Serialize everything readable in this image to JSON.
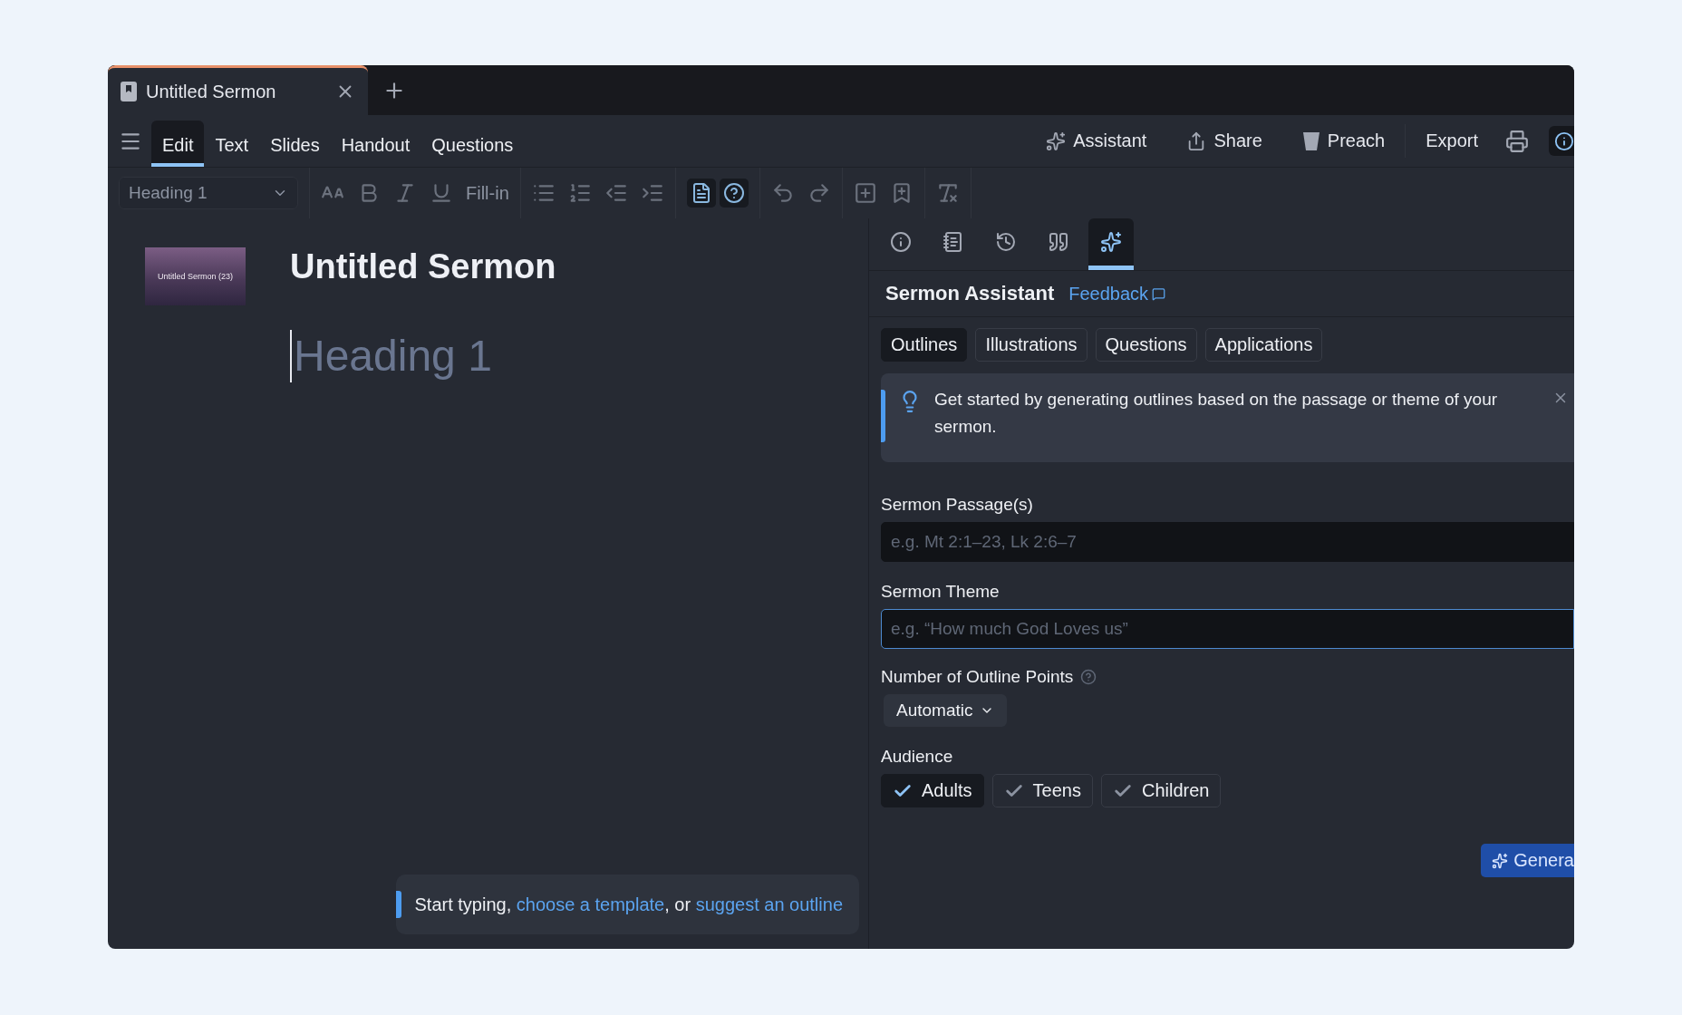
{
  "tabs": [
    {
      "title": "Untitled Sermon",
      "selected": true
    }
  ],
  "menu": [
    {
      "label": "Edit",
      "selected": true
    },
    {
      "label": "Text",
      "selected": false
    },
    {
      "label": "Slides",
      "selected": false
    },
    {
      "label": "Handout",
      "selected": false
    },
    {
      "label": "Questions",
      "selected": false
    }
  ],
  "actions": [
    {
      "label": "Assistant",
      "kind": "assistant"
    },
    {
      "label": "Share",
      "kind": "share"
    },
    {
      "label": "Preach",
      "kind": "preach"
    },
    {
      "label": "Export",
      "kind": "export"
    }
  ],
  "toolbar": {
    "style": "Heading 1",
    "fill_in": "Fill-in",
    "view_toggles": [
      {
        "kind": "outline",
        "on": true
      },
      {
        "kind": "question",
        "on": true
      }
    ]
  },
  "document": {
    "thumbnail_caption": "Untitled Sermon (23)",
    "title": "Untitled Sermon",
    "placeholder": "Heading 1"
  },
  "hint": [
    {
      "kind": "text",
      "text": "Start typing, "
    },
    {
      "kind": "link",
      "text": "choose a template"
    },
    {
      "kind": "text",
      "text": ", or "
    },
    {
      "kind": "link",
      "text": "suggest an outline"
    }
  ],
  "panel": {
    "tabs": [
      {
        "kind": "info",
        "selected": false
      },
      {
        "kind": "notebook",
        "selected": false
      },
      {
        "kind": "history",
        "selected": false
      },
      {
        "kind": "quote",
        "selected": false
      },
      {
        "kind": "assistant",
        "selected": true
      }
    ],
    "title": "Sermon Assistant",
    "feedback": "Feedback",
    "subtabs": [
      {
        "label": "Outlines",
        "selected": true
      },
      {
        "label": "Illustrations",
        "selected": false
      },
      {
        "label": "Questions",
        "selected": false
      },
      {
        "label": "Applications",
        "selected": false
      }
    ],
    "notice": "Get started by generating outlines based on the passage or theme of your sermon.",
    "passage": {
      "label": "Sermon Passage(s)",
      "placeholder": "e.g. Mt 2:1–23, Lk 2:6–7"
    },
    "theme": {
      "label": "Sermon Theme",
      "placeholder": "e.g. “How much God Loves us”"
    },
    "outline_points": {
      "label": "Number of Outline Points",
      "value": "Automatic"
    },
    "audience": {
      "label": "Audience",
      "options": [
        {
          "label": "Adults",
          "checked": true
        },
        {
          "label": "Teens",
          "checked": false
        },
        {
          "label": "Children",
          "checked": false
        }
      ]
    },
    "generate": "Genera"
  }
}
